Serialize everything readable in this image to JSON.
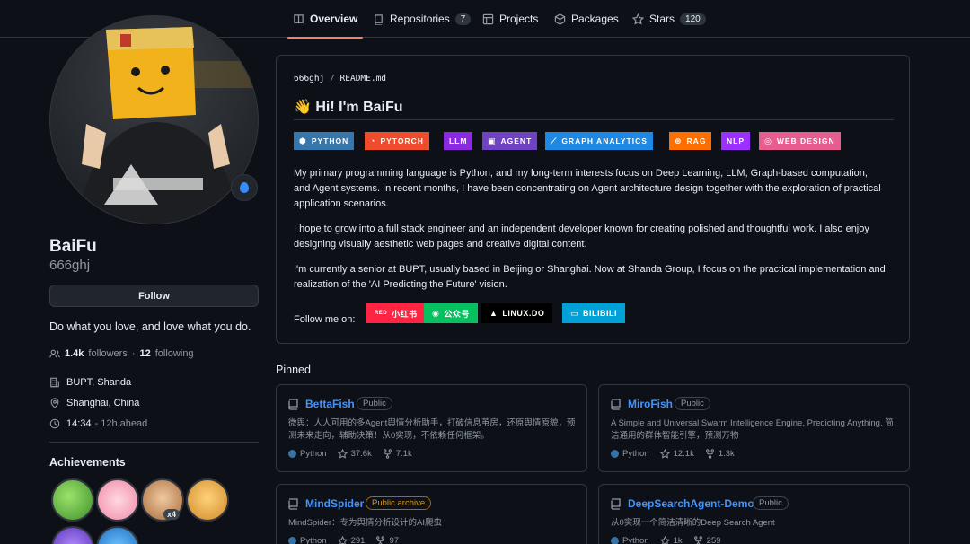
{
  "nav": {
    "tabs": [
      {
        "label": "Overview",
        "icon": "book-icon"
      },
      {
        "label": "Repositories",
        "icon": "repo-icon",
        "count": "7"
      },
      {
        "label": "Projects",
        "icon": "table-icon"
      },
      {
        "label": "Packages",
        "icon": "package-icon"
      },
      {
        "label": "Stars",
        "icon": "star-icon",
        "count": "120"
      }
    ]
  },
  "profile": {
    "name": "BaiFu",
    "login": "666ghj",
    "follow_label": "Follow",
    "bio": "Do what you love, and love what you do.",
    "followers_count": "1.4k",
    "followers_label": "followers",
    "following_count": "12",
    "following_label": "following",
    "company": "BUPT, Shanda",
    "location": "Shanghai, China",
    "time": "14:34",
    "time_note": "- 12h ahead",
    "achievements_title": "Achievements",
    "achievement_multiplier": "x4"
  },
  "readme": {
    "owner": "666ghj",
    "file": "README.md",
    "heading": "👋 Hi! I'm BaiFu",
    "tech_badges": [
      {
        "label": "PYTHON",
        "color": "#3776ab"
      },
      {
        "label": "PYTORCH",
        "color": "#ee4c2c"
      },
      {
        "label": "LLM",
        "color": "#8a2be2"
      },
      {
        "label": "AGENT",
        "color": "#6f42c1"
      },
      {
        "label": "GRAPH ANALYTICS",
        "color": "#1e88e5"
      },
      {
        "label": "RAG",
        "color": "#ff6f00"
      },
      {
        "label": "NLP",
        "color": "#9b30ff"
      },
      {
        "label": "WEB DESIGN",
        "color": "#e85d8f"
      }
    ],
    "paragraph1": "My primary programming language is Python, and my long-term interests focus on Deep Learning, LLM, Graph-based computation, and Agent systems. In recent months, I have been concentrating on Agent architecture design together with the exploration of practical application scenarios.",
    "paragraph2": "I hope to grow into a full stack engineer and an independent developer known for creating polished and thoughtful work. I also enjoy designing visually aesthetic web pages and creative digital content.",
    "paragraph3": "I'm currently a senior at BUPT, usually based in Beijing or Shanghai. Now at Shanda Group, I focus on the practical implementation and realization of the 'AI Predicting the Future' vision.",
    "follow_me": "Follow me on:",
    "socials": [
      {
        "label": "小红书",
        "prefix": "RED",
        "color": "#ff2442"
      },
      {
        "label": "公众号",
        "color": "#07c160"
      },
      {
        "label": "LINUX.DO",
        "color": "#000000"
      },
      {
        "label": "BILIBILI",
        "color": "#00a1d6"
      }
    ]
  },
  "pinned": {
    "title": "Pinned",
    "cards": [
      {
        "name": "BettaFish",
        "visibility": "Public",
        "desc": "微舆：人人可用的多Agent舆情分析助手，打破信息茧房，还原舆情原貌，预测未来走向，辅助决策！从0实现，不依赖任何框架。",
        "lang": "Python",
        "stars": "37.6k",
        "forks": "7.1k"
      },
      {
        "name": "MiroFish",
        "visibility": "Public",
        "desc": "A Simple and Universal Swarm Intelligence Engine, Predicting Anything. 简洁通用的群体智能引擎，预测万物",
        "lang": "Python",
        "stars": "12.1k",
        "forks": "1.3k"
      },
      {
        "name": "MindSpider",
        "visibility": "Public archive",
        "desc": "MindSpider：专为舆情分析设计的AI爬虫",
        "lang": "Python",
        "stars": "291",
        "forks": "97"
      },
      {
        "name": "DeepSearchAgent-Demo",
        "visibility": "Public",
        "desc": "从0实现一个简洁清晰的Deep Search Agent",
        "lang": "Python",
        "stars": "1k",
        "forks": "259"
      }
    ]
  }
}
